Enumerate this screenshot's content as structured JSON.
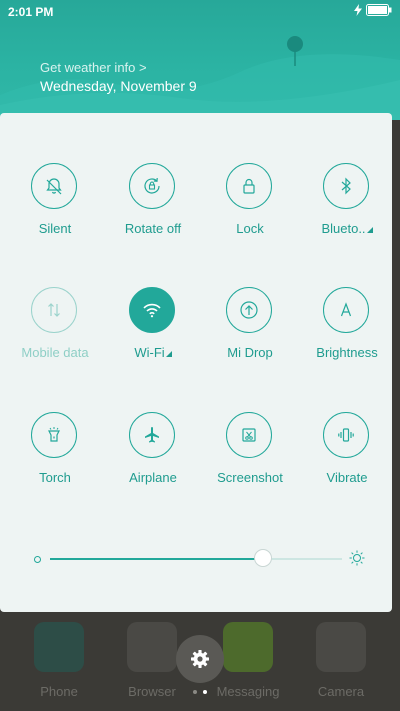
{
  "status": {
    "time": "2:01 PM",
    "battery_level": 1.0
  },
  "header": {
    "weather_link": "Get weather info >",
    "date": "Wednesday, November 9"
  },
  "tiles": [
    {
      "label": "Silent",
      "icon": "bell-off-icon",
      "state": "off"
    },
    {
      "label": "Rotate off",
      "icon": "rotate-lock-icon",
      "state": "off"
    },
    {
      "label": "Lock",
      "icon": "lock-icon",
      "state": "off"
    },
    {
      "label": "Blueto..",
      "icon": "bluetooth-icon",
      "state": "off",
      "has_menu": true
    },
    {
      "label": "Mobile data",
      "icon": "mobile-data-icon",
      "state": "disabled"
    },
    {
      "label": "Wi-Fi",
      "icon": "wifi-icon",
      "state": "on",
      "has_menu": true
    },
    {
      "label": "Mi Drop",
      "icon": "mi-drop-icon",
      "state": "off"
    },
    {
      "label": "Brightness",
      "icon": "brightness-auto-icon",
      "state": "off"
    },
    {
      "label": "Torch",
      "icon": "torch-icon",
      "state": "off"
    },
    {
      "label": "Airplane",
      "icon": "airplane-icon",
      "state": "off"
    },
    {
      "label": "Screenshot",
      "icon": "screenshot-icon",
      "state": "off"
    },
    {
      "label": "Vibrate",
      "icon": "vibrate-icon",
      "state": "off"
    }
  ],
  "brightness": {
    "level": 0.73
  },
  "dock": {
    "apps": [
      {
        "name": "Phone",
        "icon": "phone-app-icon",
        "color": "#2d4d47"
      },
      {
        "name": "Browser",
        "icon": "browser-app-icon",
        "color": "#4a4945"
      },
      {
        "name": "Messaging",
        "icon": "messaging-app-icon",
        "color": "#4d6a2c"
      },
      {
        "name": "Camera",
        "icon": "camera-app-icon",
        "color": "#4a4945"
      }
    ]
  },
  "pager": {
    "pages": 2,
    "current": 2
  },
  "colors": {
    "accent": "#22a89a",
    "panel": "#eef4f3",
    "header": "#2bb3a3"
  }
}
